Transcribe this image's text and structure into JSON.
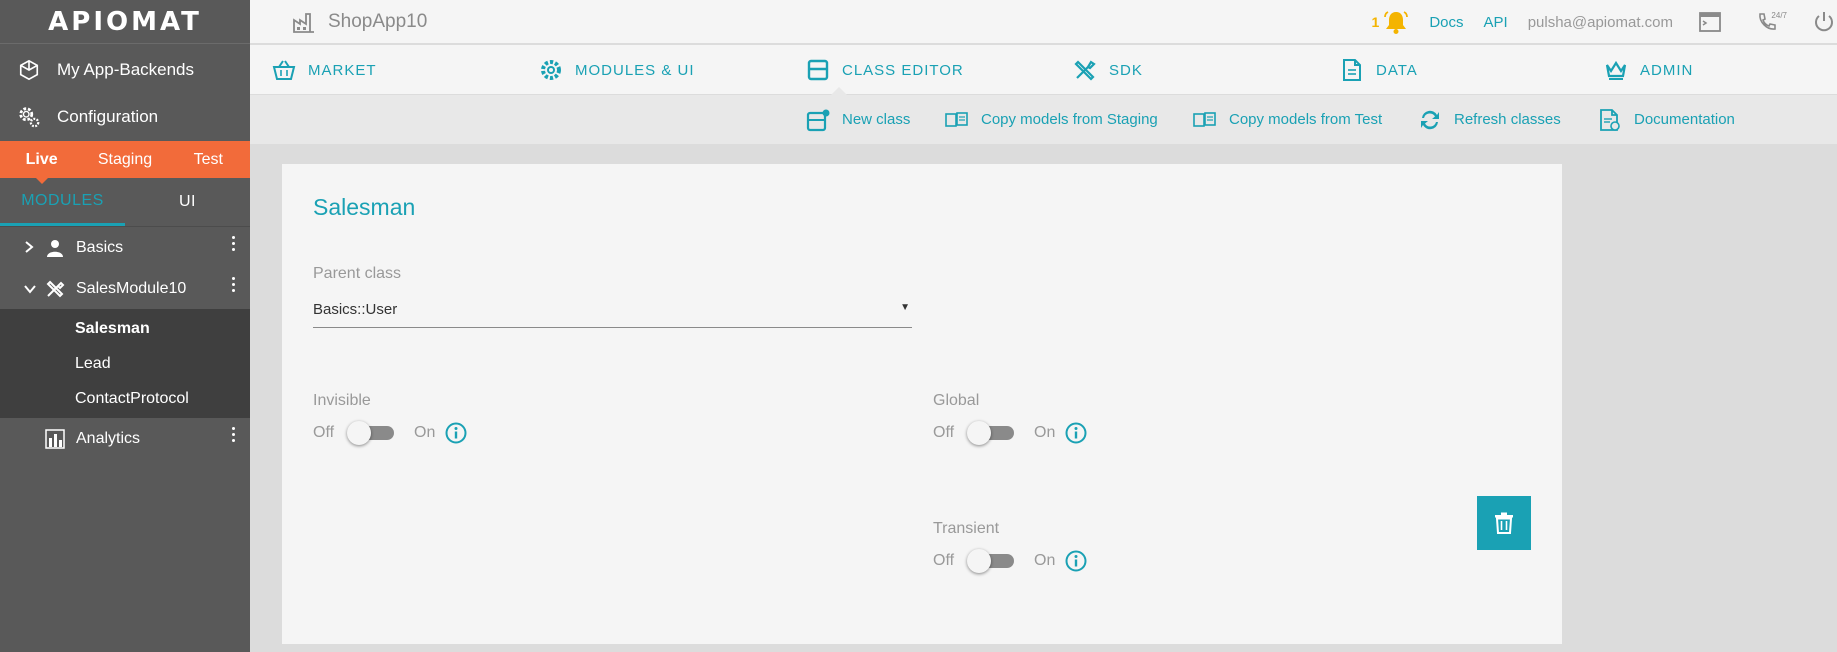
{
  "logo": "APIOMAT",
  "colors": {
    "accent": "#1aa1b4",
    "env_bar": "#f26b3a",
    "sidebar": "#595959",
    "notification": "#f4b400"
  },
  "sidebar": {
    "links": [
      {
        "label": "My App-Backends",
        "icon": "cube-icon"
      },
      {
        "label": "Configuration",
        "icon": "gears-icon"
      }
    ],
    "environments": [
      "Live",
      "Staging",
      "Test"
    ],
    "active_environment": "Live",
    "module_tabs": [
      "MODULES",
      "UI"
    ],
    "active_module_tab": "MODULES",
    "modules": [
      {
        "label": "Basics",
        "icon": "user-icon",
        "expanded": false
      },
      {
        "label": "SalesModule10",
        "icon": "tools-icon",
        "expanded": true,
        "classes": [
          "Salesman",
          "Lead",
          "ContactProtocol"
        ],
        "active_class": "Salesman"
      },
      {
        "label": "Analytics",
        "icon": "analytics-icon",
        "expanded": false
      }
    ]
  },
  "topbar": {
    "app_name": "ShopApp10",
    "notification_count": "1",
    "docs": "Docs",
    "api": "API",
    "email": "pulsha@apiomat.com",
    "support_label": "24/7"
  },
  "nav": {
    "items": [
      {
        "label": "MARKET",
        "icon": "basket-icon"
      },
      {
        "label": "MODULES & UI",
        "icon": "gear-icon"
      },
      {
        "label": "CLASS EDITOR",
        "icon": "class-editor-icon"
      },
      {
        "label": "SDK",
        "icon": "tools-icon"
      },
      {
        "label": "DATA",
        "icon": "document-icon"
      },
      {
        "label": "ADMIN",
        "icon": "crown-icon"
      }
    ],
    "active": "CLASS EDITOR"
  },
  "subnav": {
    "actions": [
      {
        "label": "New class",
        "icon": "new-class-icon"
      },
      {
        "label": "Copy models from Staging",
        "icon": "copy-icon"
      },
      {
        "label": "Copy models from Test",
        "icon": "copy-icon"
      },
      {
        "label": "Refresh classes",
        "icon": "refresh-icon"
      },
      {
        "label": "Documentation",
        "icon": "documentation-icon"
      }
    ]
  },
  "card": {
    "title": "Salesman",
    "parent_class_label": "Parent class",
    "parent_class_value": "Basics::User",
    "toggles": [
      {
        "label": "Invisible",
        "off": "Off",
        "on": "On",
        "value": false
      },
      {
        "label": "Global",
        "off": "Off",
        "on": "On",
        "value": false
      },
      {
        "label": "Transient",
        "off": "Off",
        "on": "On",
        "value": false
      }
    ]
  }
}
